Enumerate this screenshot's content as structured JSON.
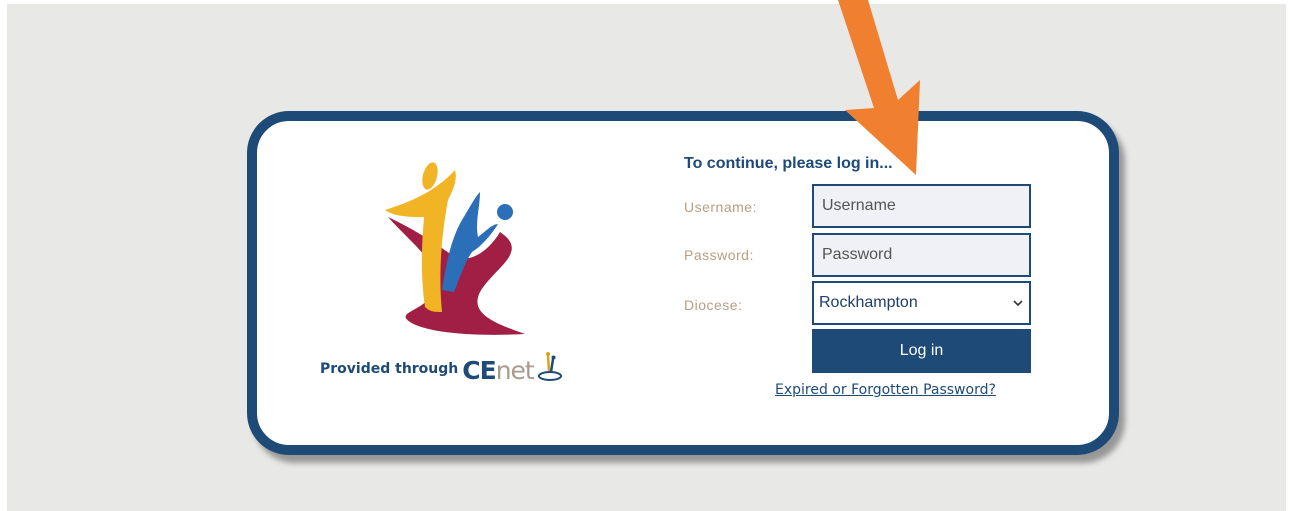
{
  "login": {
    "title": "To continue, please log in...",
    "username_label": "Username:",
    "username_placeholder": "Username",
    "password_label": "Password:",
    "password_placeholder": "Password",
    "diocese_label": "Diocese:",
    "diocese_value": "Rockhampton",
    "login_button": "Log in",
    "forgot_link": "Expired or Forgotten Password?"
  },
  "branding": {
    "provided_text": "Provided through",
    "brand_ce": "CE",
    "brand_net": "net"
  },
  "icons": {
    "logo": "catholic-education-logo",
    "cenet": "cenet-logo-icon",
    "dropdown": "chevron-down-icon",
    "annotation": "orange-arrow-pointer"
  },
  "colors": {
    "navy": "#1e4a78",
    "label": "#b59f85",
    "arrow": "#f07f30",
    "background": "#e8e8e6"
  }
}
